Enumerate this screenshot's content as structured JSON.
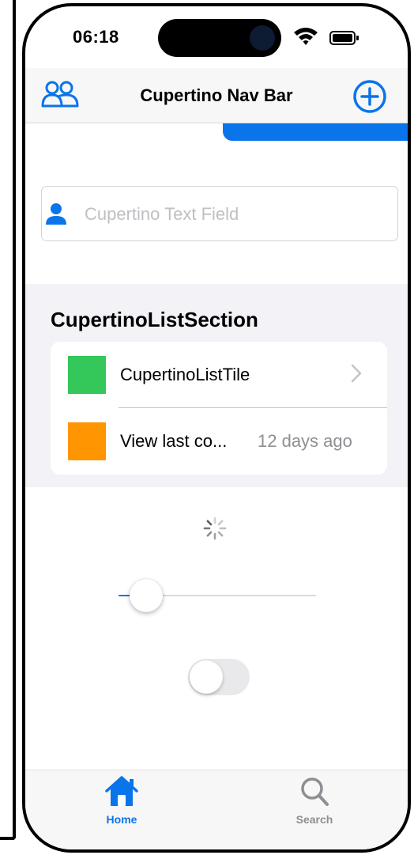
{
  "status_bar": {
    "time": "06:18"
  },
  "nav_bar": {
    "title": "Cupertino Nav Bar",
    "left_icon": "people-icon",
    "right_icon": "add-circle-icon"
  },
  "text_field": {
    "placeholder": "Cupertino Text Field",
    "value": "",
    "icon": "person-icon"
  },
  "list_section": {
    "title": "CupertinoListSection",
    "tiles": [
      {
        "label": "CupertinoListTile",
        "swatch_color": "#34c759",
        "trailing": "chevron-right-icon"
      },
      {
        "label": "View last co...",
        "swatch_color": "#ff9500",
        "detail": "12 days ago"
      }
    ]
  },
  "slider": {
    "value": 0.14
  },
  "switch": {
    "on": false
  },
  "tab_bar": {
    "tabs": [
      {
        "label": "Home",
        "icon": "home-icon",
        "active": true
      },
      {
        "label": "Search",
        "icon": "search-icon",
        "active": false
      }
    ]
  },
  "colors": {
    "accent": "#0a74ea",
    "green": "#34c759",
    "orange": "#ff9500",
    "inactive": "#8e8e93"
  }
}
